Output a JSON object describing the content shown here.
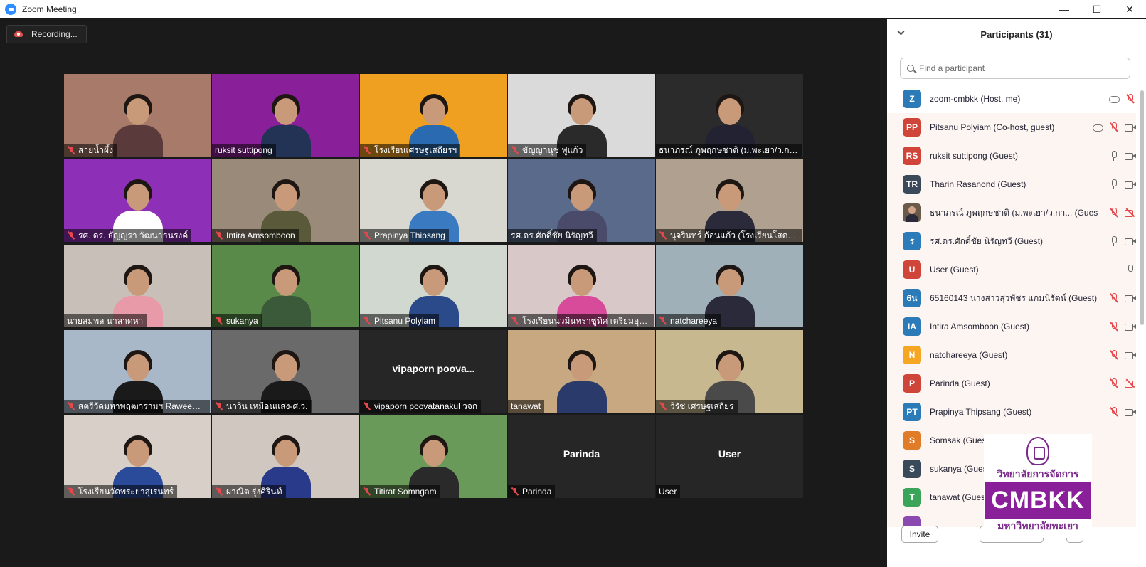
{
  "window": {
    "title": "Zoom Meeting",
    "controls": [
      "minimize",
      "maximize",
      "close"
    ]
  },
  "recording_label": "Recording...",
  "tiles": [
    {
      "name": "สายน้ำผึ้ง",
      "muted": true,
      "bg": "#a87a6a",
      "shirt": "#5a3a3a"
    },
    {
      "name": "ruksit suttipong",
      "muted": false,
      "bg": "#8a1f9a",
      "shirt": "#223355",
      "overlay": "CMBKK"
    },
    {
      "name": "โรงเรียนเศรษฐเสถียรฯ",
      "muted": true,
      "bg": "#f0a020",
      "shirt": "#2a6ab0"
    },
    {
      "name": "ขัญญานุช ฟูแก้ว",
      "muted": true,
      "bg": "#dadada",
      "shirt": "#2a2a2a"
    },
    {
      "name": "ธนาภรณ์ ภูพฤกษชาติ (ม.พะเยา/ว.การ...",
      "muted": false,
      "bg": "#2b2b2b",
      "shirt": "#222233",
      "active": true
    },
    {
      "name": "รศ. ดร. ธัญญรา วัฒนาธนรงค์",
      "muted": true,
      "bg": "#8e2fb8",
      "shirt": "#ffffff"
    },
    {
      "name": "Intira Amsomboon",
      "muted": true,
      "bg": "#9a8a7a",
      "shirt": "#5a5a3a"
    },
    {
      "name": "Prapinya  Thipsang",
      "muted": true,
      "bg": "#d8d8d0",
      "shirt": "#3a7ac0"
    },
    {
      "name": "รศ.ดร.ศักดิ์ชัย นิรัญทวี",
      "muted": false,
      "bg": "#5a6a8a",
      "shirt": "#4a4a6a"
    },
    {
      "name": "นุจรินทร์ ก้อนแก้ว (โรงเรียนโสตศึก...",
      "muted": true,
      "bg": "#b0a090",
      "shirt": "#2a2a3a"
    },
    {
      "name": "นายสมพล นาลาดหา",
      "muted": false,
      "bg": "#c8c0b8",
      "shirt": "#e89aa8"
    },
    {
      "name": "sukanya",
      "muted": true,
      "bg": "#5a8a4a",
      "shirt": "#3a5a3a"
    },
    {
      "name": "Pitsanu Polyiam",
      "muted": true,
      "bg": "#d0d8d0",
      "shirt": "#2a4a8a"
    },
    {
      "name": "โรงเรียนนวมินทราชูทิศ เตรียมอุดมศึ...",
      "muted": true,
      "bg": "#d8c8c8",
      "shirt": "#d84a9a"
    },
    {
      "name": "natchareeya",
      "muted": true,
      "bg": "#a0b0b8",
      "shirt": "#2a2a3a"
    },
    {
      "name": "สตรีวัดมหาพฤฒารามฯ Raweewa...",
      "muted": true,
      "bg": "#a8b8c8",
      "shirt": "#1a1a1a"
    },
    {
      "name": "นาวิน เหมือนแสง-ศ.ว.",
      "muted": true,
      "bg": "#6a6a6a",
      "shirt": "#1a1a1a"
    },
    {
      "name": "vipaporn poovatanakul วจก",
      "muted": true,
      "bg": "#262626",
      "center": "vipaporn  poova..."
    },
    {
      "name": "tanawat",
      "muted": false,
      "bg": "#c8a880",
      "shirt": "#2a3a6a"
    },
    {
      "name": "วิรัช เศรษฐเสถียร",
      "muted": true,
      "bg": "#c8b890",
      "shirt": "#4a4a4a"
    },
    {
      "name": "โรงเรียนวัดพระยาสุเรนทร์",
      "muted": true,
      "bg": "#d8d0c8",
      "shirt": "#2a4a9a"
    },
    {
      "name": "ผาณิต รุ่งศิรินท์",
      "muted": true,
      "bg": "#d0c8c0",
      "shirt": "#2a3a8a"
    },
    {
      "name": "Titirat Somngam",
      "muted": true,
      "bg": "#6a9a5a",
      "shirt": "#2a2a2a"
    },
    {
      "name": "Parinda",
      "muted": true,
      "bg": "#262626",
      "center": "Parinda"
    },
    {
      "name": "User",
      "muted": false,
      "bg": "#262626",
      "center": "User"
    }
  ],
  "participants_panel": {
    "title": "Participants (31)",
    "search_placeholder": "Find a participant",
    "invite_label": "Invite",
    "participants": [
      {
        "initials": "Z",
        "color": "#2b7bb9",
        "name": "zoom-cmbkk (Host, me)",
        "icons": [
          "cloud",
          "mic-off"
        ]
      },
      {
        "initials": "PP",
        "color": "#d0453a",
        "name": "Pitsanu Polyiam (Co-host, guest)",
        "icons": [
          "cloud",
          "mic-off",
          "cam"
        ],
        "hl": true
      },
      {
        "initials": "RS",
        "color": "#d0453a",
        "name": "ruksit suttipong (Guest)",
        "icons": [
          "mic",
          "cam"
        ],
        "hl": true
      },
      {
        "initials": "TR",
        "color": "#3a4a5a",
        "name": "Tharin Rasanond (Guest)",
        "icons": [
          "mic",
          "cam"
        ],
        "hl": true
      },
      {
        "initials": "",
        "color": "#6a5a4a",
        "name": "ธนาภรณ์ ภูพฤกษชาติ (ม.พะเยา/ว.กา... (Guest)",
        "icons": [
          "mic-off",
          "cam-off"
        ],
        "hl": true,
        "photo": true
      },
      {
        "initials": "ร",
        "color": "#2b7bb9",
        "name": "รศ.ดร.ศักดิ์ชัย นิรัญทวี (Guest)",
        "icons": [
          "mic",
          "cam"
        ],
        "hl": true
      },
      {
        "initials": "U",
        "color": "#d0453a",
        "name": "User (Guest)",
        "icons": [
          "mic"
        ],
        "hl": true
      },
      {
        "initials": "6น",
        "color": "#2b7bb9",
        "name": "65160143 นางสาวสุวพัชร แกมนิรัตน์ (Guest)",
        "icons": [
          "mic-off",
          "cam"
        ],
        "hl": true
      },
      {
        "initials": "IA",
        "color": "#2b7bb9",
        "name": "Intira Amsomboon (Guest)",
        "icons": [
          "mic-off",
          "cam"
        ],
        "hl": true
      },
      {
        "initials": "N",
        "color": "#f5a623",
        "name": "natchareeya (Guest)",
        "icons": [
          "mic-off",
          "cam"
        ],
        "hl": true
      },
      {
        "initials": "P",
        "color": "#d0453a",
        "name": "Parinda (Guest)",
        "icons": [
          "mic-off",
          "cam-off"
        ],
        "hl": true
      },
      {
        "initials": "PT",
        "color": "#2b7bb9",
        "name": "Prapinya  Thipsang (Guest)",
        "icons": [
          "mic-off",
          "cam"
        ],
        "hl": true
      },
      {
        "initials": "S",
        "color": "#e07b28",
        "name": "Somsak (Guest)",
        "icons": [],
        "hl": true
      },
      {
        "initials": "S",
        "color": "#3a4a5a",
        "name": "sukanya (Guest)",
        "icons": [],
        "hl": true
      },
      {
        "initials": "T",
        "color": "#3aa55a",
        "name": "tanawat (Guest)",
        "icons": [],
        "hl": true
      },
      {
        "initials": "",
        "color": "#8a4ab0",
        "name": "",
        "icons": [],
        "hl": true
      }
    ]
  },
  "watermark": {
    "top": "วิทยาลัยการจัดการ",
    "big": "CMBKK",
    "bottom": "มหาวิทยาลัยพะเยา"
  }
}
